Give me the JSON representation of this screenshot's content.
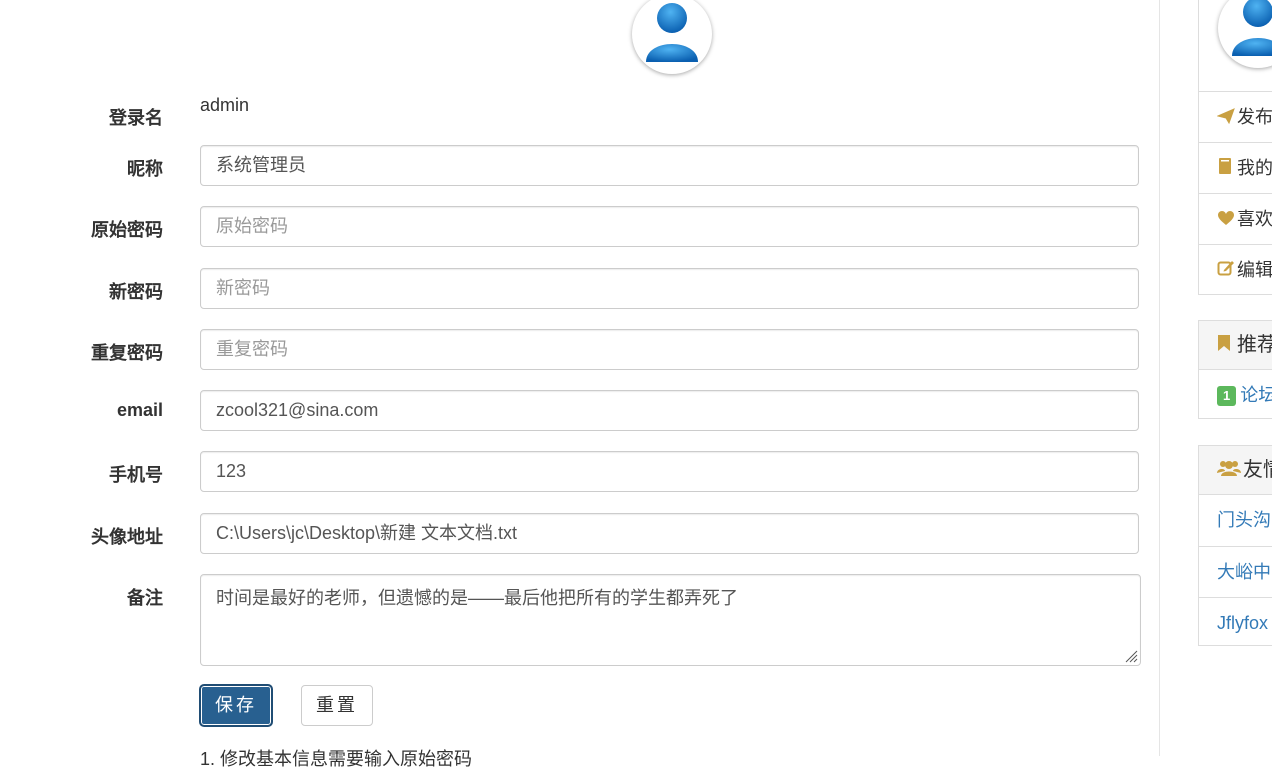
{
  "colors": {
    "accent": "#286090",
    "icon_gold": "#c9a042",
    "link": "#337ab7",
    "badge_green": "#5cb85c"
  },
  "form": {
    "login_name": {
      "label": "登录名",
      "value": "admin"
    },
    "nickname": {
      "label": "昵称",
      "value": "系统管理员"
    },
    "old_password": {
      "label": "原始密码",
      "placeholder": "原始密码"
    },
    "new_password": {
      "label": "新密码",
      "placeholder": "新密码"
    },
    "repeat_password": {
      "label": "重复密码",
      "placeholder": "重复密码"
    },
    "email": {
      "label": "email",
      "value": "zcool321@sina.com"
    },
    "phone": {
      "label": "手机号",
      "value": "123"
    },
    "avatar_url": {
      "label": "头像地址",
      "value": "C:\\Users\\jc\\Desktop\\新建 文本文档.txt"
    },
    "remark": {
      "label": "备注",
      "value": "时间是最好的老师，但遗憾的是——最后他把所有的学生都弄死了"
    },
    "save_label": "保存",
    "reset_label": "重置",
    "note": "1. 修改基本信息需要输入原始密码"
  },
  "sidebar": {
    "menu": [
      {
        "icon": "paper-plane-icon",
        "label": "发布"
      },
      {
        "icon": "book-icon",
        "label": "我的"
      },
      {
        "icon": "heart-icon",
        "label": "喜欢"
      },
      {
        "icon": "edit-icon",
        "label": "编辑"
      }
    ],
    "recommend": {
      "icon": "bookmark-icon",
      "title": "推荐",
      "items": [
        {
          "badge": "1",
          "label": "论坛"
        }
      ]
    },
    "friends": {
      "icon": "users-icon",
      "title": "友情",
      "items": [
        "门头沟",
        "大峪中",
        "Jflyfox"
      ]
    }
  }
}
